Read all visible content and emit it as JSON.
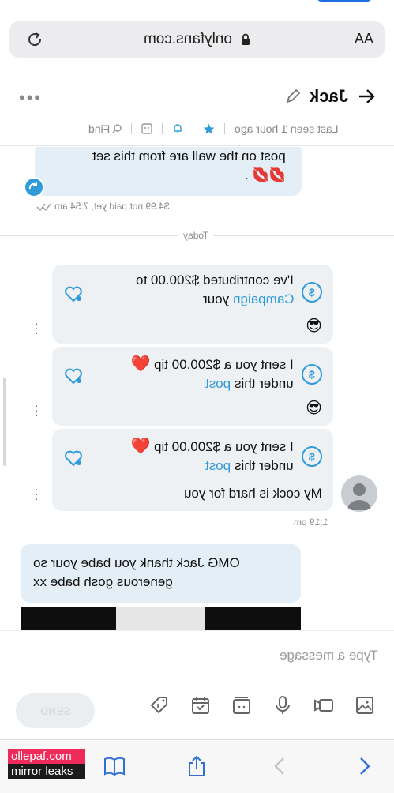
{
  "browser": {
    "host": "onlyfans.com",
    "text_size_label": "AA"
  },
  "header": {
    "contact_name": "Jack",
    "last_seen": "Last seen 1 hour ago",
    "find_label": "Find"
  },
  "messages": {
    "prev_message_text": "post on the wall are from this set",
    "prev_message_emoji": "💋💋 .",
    "prev_message_meta": "$4.99 not paid yet, 7:54 am",
    "day_divider": "Today",
    "tip1_text_a": "I've contributed $200.00 to",
    "tip1_text_b": "your",
    "tip1_link": "Campaign",
    "tip1_emoji": "😎",
    "tip2_text_a": "I sent you a $200.00 tip",
    "tip2_heart": "❤️",
    "tip2_text_b": "under this",
    "tip2_link": "post",
    "tip2_emoji": "😎",
    "tip3_text_a": "I sent you a $200.00 tip",
    "tip3_heart": "❤️",
    "tip3_text_b": "under this",
    "tip3_link": "post",
    "tip3_text_c": "My cock is hard for you",
    "incoming_time": "1:19 pm",
    "reply_text": "OMG Jack thank you babe your so generous gosh babe xx"
  },
  "composer": {
    "placeholder": "Type a message",
    "send_label": "SEND"
  },
  "watermark": {
    "line1": "ollepaf.com",
    "line2": "mirror leaks"
  },
  "colors": {
    "accent": "#2f9bd9",
    "bubble_incoming": "#e3eef6",
    "bubble_tip": "#eef1f3"
  }
}
